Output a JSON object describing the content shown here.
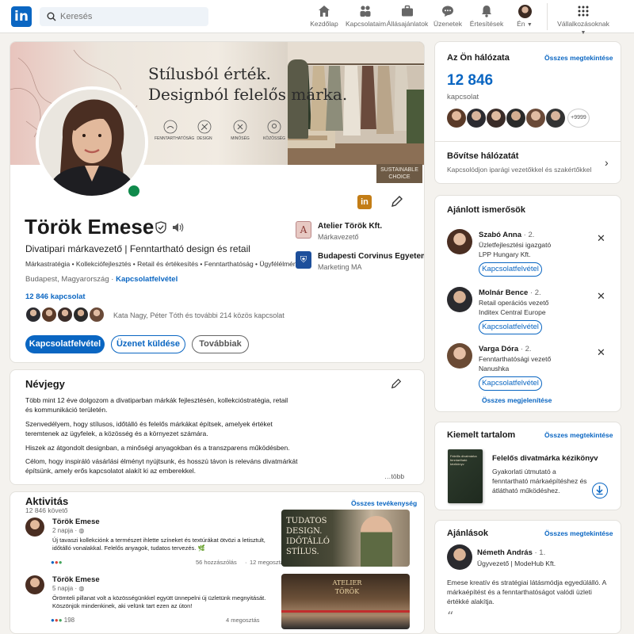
{
  "nav": {
    "logo": "in",
    "search_placeholder": "Keresés",
    "items": [
      "Kezdőlap",
      "Kapcsolataim",
      "Állásajánlatok",
      "Üzenetek",
      "Értesítések",
      "Én"
    ],
    "business": "Vállalkozásoknak"
  },
  "profile": {
    "banner_line1": "Stílusból érték.",
    "banner_line2": "Designból felelős márka.",
    "banner_icons": [
      "FENNTARTHATÓSÁG",
      "DESIGN",
      "MINŐSÉG",
      "KÖZÖSSÉG"
    ],
    "banner_badge_line1": "SUSTAINABLE",
    "banner_badge_line2": "CHOICE",
    "name": "Török Emese",
    "headline": "Divatipari márkavezető | Fenntartható design és retail",
    "skills": "Márkastratégia • Kollekciófejlesztés • Retail és értékesítés • Fenntarthatóság • Ügyfélélmény",
    "location": "Budapest, Magyarország",
    "contact_link": "Kapcsolatfelvétel",
    "connections": "12 846 kapcsolat",
    "mutual": "Kata Nagy, Péter Tóth és további 214 közös kapcsolat",
    "btn_connect": "Kapcsolatfelvétel",
    "btn_message": "Üzenet küldése",
    "btn_more": "Továbbiak",
    "company": {
      "name": "Atelier Török Kft.",
      "role": "Márkavezető"
    },
    "school": {
      "name": "Budapesti Corvinus Egyetem",
      "role": "Marketing MA"
    }
  },
  "about": {
    "title": "Névjegy",
    "p1": "Több mint 12 éve dolgozom a divatiparban márkák fejlesztésén, kollekcióstratégia, retail és kommunikáció területén.",
    "p2": "Szenvedélyem, hogy stílusos, időtálló és felelős márkákat építsek, amelyek értéket teremtenek az ügyfelek, a közösség és a környezet számára.",
    "p3": "Hiszek az átgondolt designban, a minőségi anyagokban és a transzparens működésben.",
    "p4": "Célom, hogy inspiráló vásárlási élményt nyújtsunk, és hosszú távon is releváns divatmárkát építsünk, amely erős kapcsolatot alakít ki az emberekkel.",
    "more": "…több"
  },
  "activity": {
    "title": "Aktivitás",
    "followers": "12 846 követő",
    "all": "Összes tevékenység",
    "posts": [
      {
        "author": "Török Emese",
        "time": "2 napja",
        "text": "Új tavaszi kollekciónk a természet ihlette színeket és textúrákat ötvözi a letisztult, időtálló vonalakkal. Felelős anyagok, tudatos tervezés. 🌿",
        "reactions": "56 hozzászólás",
        "shares": "12 megosztás",
        "image_text": "TUDATOS DESIGN. IDŐTÁLLÓ STÍLUS."
      },
      {
        "author": "Török Emese",
        "time": "5 napja",
        "text": "Örömteli pillanat volt a közösségünkkel együtt ünnepelni új üzletünk megnyitását. Köszönjük mindenkinek, aki velünk tart ezen az úton!",
        "reaction_count": "198",
        "reactions": "",
        "shares": "4 megosztás",
        "image_text": "ATELIER TÖRÖK"
      }
    ]
  },
  "network": {
    "title": "Az Ön hálózata",
    "see_all": "Összes megtekintése",
    "count": "12 846",
    "label": "kapcsolat",
    "plus": "+9999",
    "grow_title": "Bővítse hálózatát",
    "grow_sub": "Kapcsolódjon iparági vezetőkkel és szakértőkkel"
  },
  "suggested": {
    "title": "Ajánlott ismerősök",
    "people": [
      {
        "name": "Szabó Anna",
        "degree": "· 2.",
        "role": "Üzletfejlesztési igazgató",
        "company": "LPP Hungary Kft."
      },
      {
        "name": "Molnár Bence",
        "degree": "· 2.",
        "role": "Retail operációs vezető",
        "company": "Inditex Central Europe"
      },
      {
        "name": "Varga Dóra",
        "degree": "· 2.",
        "role": "Fenntarthatósági vezető",
        "company": "Nanushka"
      }
    ],
    "connect": "Kapcsolatfelvétel",
    "show_all": "Összes megjelenítése"
  },
  "featured": {
    "title": "Kiemelt tartalom",
    "see_all": "Összes megtekintése",
    "book_title": "Felelős divatmárka kézikönyv",
    "book_cover": "Felelős divatmárka fenntartható kézikönyv",
    "desc": "Gyakorlati útmutató a fenntartható márkaépítéshez és átlátható működéshez."
  },
  "recommendations": {
    "title": "Ajánlások",
    "see_all": "Összes megtekintése",
    "name": "Németh András",
    "degree": "· 1.",
    "role": "Ügyvezető | ModeHub Kft.",
    "text": "Emese kreatív és stratégiai látásmódja egyedülálló. A márkaépítést és a fenntarthatóságot valódi üzleti értékké alakítja.",
    "quote": "“"
  },
  "colors": {
    "accent": "#0a66c2",
    "green": "#0f8a4b"
  }
}
